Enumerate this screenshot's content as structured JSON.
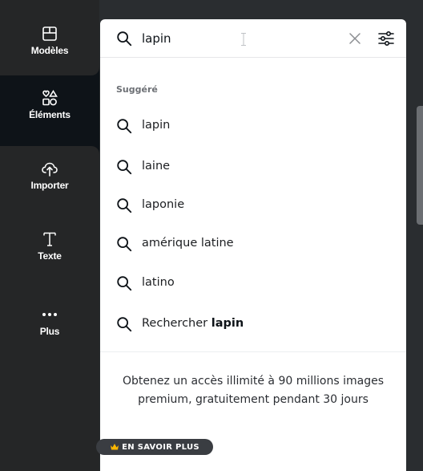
{
  "sidebar": {
    "items": [
      {
        "label": "Modèles",
        "icon": "templates-icon"
      },
      {
        "label": "Éléments",
        "icon": "elements-icon",
        "active": true
      },
      {
        "label": "Importer",
        "icon": "upload-cloud-icon"
      },
      {
        "label": "Texte",
        "icon": "text-icon"
      },
      {
        "label": "Plus",
        "icon": "more-icon"
      }
    ]
  },
  "search": {
    "value": "lapin",
    "placeholder": "",
    "clear_icon": "close-icon",
    "filter_icon": "filter-sliders-icon"
  },
  "suggestions": {
    "title": "Suggéré",
    "items": [
      {
        "text": "lapin"
      },
      {
        "text": "laine"
      },
      {
        "text": "laponie"
      },
      {
        "text": "amérique latine"
      },
      {
        "text": "latino"
      }
    ],
    "search_for": {
      "prefix": "Rechercher",
      "term": "lapin"
    }
  },
  "promo": {
    "text": "Obtenez un accès illimité à 90 millions images premium, gratuitement pendant 30 jours",
    "button_label": "EN SAVOIR PLUS",
    "button_icon": "crown-icon"
  },
  "colors": {
    "rail_bg": "#0e1318",
    "panel_bg": "#2a2d30",
    "card_bg": "#ffffff",
    "crown": "#ffb800"
  }
}
